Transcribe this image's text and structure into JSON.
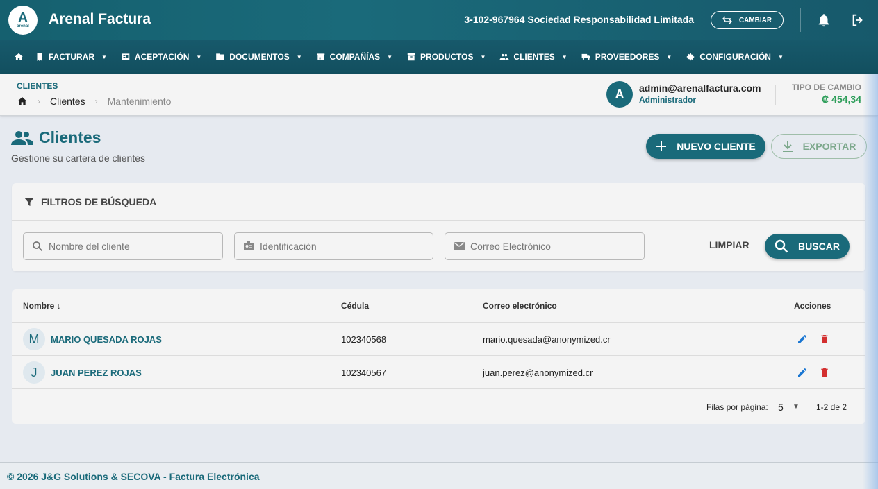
{
  "header": {
    "logo_text": "A",
    "logo_sub": "arenal",
    "app_title": "Arenal Factura",
    "company": "3-102-967964 Sociedad Responsabilidad Limitada",
    "cambiar_label": "CAMBIAR"
  },
  "nav": {
    "items": [
      {
        "label": "FACTURAR",
        "icon": "invoice-icon"
      },
      {
        "label": "ACEPTACIÓN",
        "icon": "acceptance-icon"
      },
      {
        "label": "DOCUMENTOS",
        "icon": "folder-icon"
      },
      {
        "label": "COMPAÑÍAS",
        "icon": "store-icon"
      },
      {
        "label": "PRODUCTOS",
        "icon": "archive-icon"
      },
      {
        "label": "CLIENTES",
        "icon": "people-icon"
      },
      {
        "label": "PROVEEDORES",
        "icon": "truck-icon"
      },
      {
        "label": "CONFIGURACIÓN",
        "icon": "gear-icon"
      }
    ]
  },
  "breadcrumb": {
    "section": "CLIENTES",
    "items": [
      "Clientes",
      "Mantenimiento"
    ]
  },
  "user": {
    "initial": "A",
    "email": "admin@arenalfactura.com",
    "role": "Administrador"
  },
  "exchange": {
    "label": "TIPO DE CAMBIO",
    "value": "₡ 454,34"
  },
  "page": {
    "title": "Clientes",
    "subtitle": "Gestione su cartera de clientes",
    "nuevo_label": "NUEVO CLIENTE",
    "exportar_label": "EXPORTAR"
  },
  "filters": {
    "title": "FILTROS DE BÚSQUEDA",
    "name_placeholder": "Nombre del cliente",
    "id_placeholder": "Identificación",
    "email_placeholder": "Correo Electrónico",
    "limpiar_label": "LIMPIAR",
    "buscar_label": "BUSCAR"
  },
  "table": {
    "columns": [
      "Nombre",
      "Cédula",
      "Correo electrónico",
      "Acciones"
    ],
    "rows": [
      {
        "initial": "M",
        "name": "MARIO QUESADA ROJAS",
        "cedula": "102340568",
        "email": "mario.quesada@anonymized.cr"
      },
      {
        "initial": "J",
        "name": "JUAN PEREZ ROJAS",
        "cedula": "102340567",
        "email": "juan.perez@anonymized.cr"
      }
    ],
    "rows_per_page_label": "Filas por página:",
    "rows_per_page": "5",
    "range": "1-2 de 2"
  },
  "footer": {
    "text": "© 2026 J&G Solutions & SECOVA - Factura Electrónica"
  },
  "colors": {
    "primary": "#1a6a7a",
    "success": "#2e9e5a",
    "danger": "#d32f2f",
    "edit": "#1976d2"
  }
}
